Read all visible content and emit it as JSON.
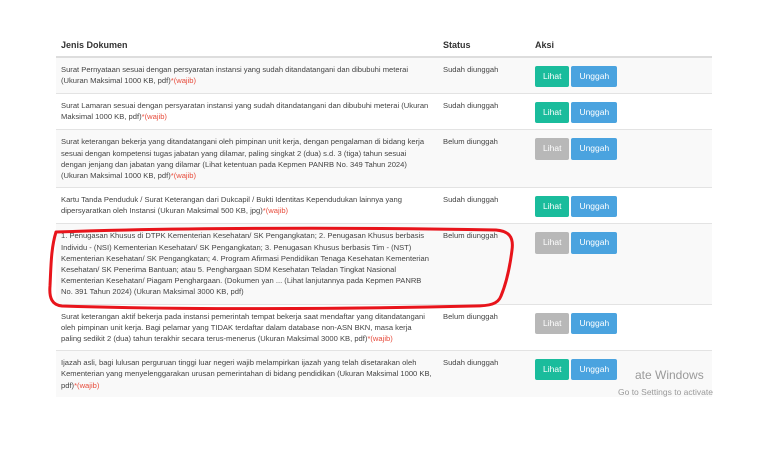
{
  "table": {
    "headers": {
      "doc": "Jenis Dokumen",
      "status": "Status",
      "action": "Aksi"
    },
    "buttons": {
      "view": "Lihat",
      "upload": "Unggah"
    },
    "rows": [
      {
        "doc": "Surat Pernyataan sesuai dengan persyaratan instansi yang sudah ditandatangani dan dibubuhi meterai (Ukuran Maksimal 1000 KB, pdf)",
        "req": "*(wajib)",
        "status": "Sudah diunggah",
        "view_enabled": true
      },
      {
        "doc": "Surat Lamaran sesuai dengan persyaratan instansi yang sudah ditandatangani dan dibubuhi meterai (Ukuran Maksimal 1000 KB, pdf)",
        "req": "*(wajib)",
        "status": "Sudah diunggah",
        "view_enabled": true
      },
      {
        "doc": "Surat keterangan bekerja yang ditandatangani oleh pimpinan unit kerja, dengan pengalaman di bidang kerja sesuai dengan kompetensi tugas jabatan yang dilamar, paling singkat 2 (dua) s.d. 3 (tiga) tahun sesuai dengan jenjang dan jabatan yang dilamar (Lihat ketentuan pada Kepmen PANRB No. 349 Tahun 2024) (Ukuran Maksimal 1000 KB, pdf)",
        "req": "*(wajib)",
        "status": "Belum diunggah",
        "view_enabled": false
      },
      {
        "doc": "Kartu Tanda Penduduk / Surat Keterangan dari Dukcapil / Bukti Identitas Kependudukan lainnya yang dipersyaratkan oleh Instansi (Ukuran Maksimal 500 KB, jpg)",
        "req": "*(wajib)",
        "status": "Sudah diunggah",
        "view_enabled": true
      },
      {
        "doc": "1. Penugasan Khusus di DTPK Kementerian Kesehatan/ SK Pengangkatan; 2. Penugasan Khusus berbasis Individu - (NSI) Kementerian Kesehatan/ SK Pengangkatan; 3. Penugasan Khusus berbasis Tim - (NST) Kementerian Kesehatan/ SK Pengangkatan; 4. Program Afirmasi Pendidikan Tenaga Kesehatan Kementerian Kesehatan/ SK Penerima Bantuan; atau 5. Penghargaan SDM Kesehatan Teladan Tingkat Nasional Kementerian Kesehatan/ Piagam Penghargaan. (Dokumen yan ... (Lihat lanjutannya pada Kepmen PANRB No. 391 Tahun 2024) (Ukuran Maksimal 3000 KB, pdf)",
        "req": "",
        "status": "Belum diunggah",
        "view_enabled": false
      },
      {
        "doc": "Surat keterangan aktif bekerja pada instansi pemerintah tempat bekerja saat mendaftar yang ditandatangani oleh pimpinan unit kerja. Bagi pelamar yang TIDAK terdaftar dalam database non-ASN BKN, masa kerja paling sedikit 2 (dua) tahun terakhir secara terus-menerus (Ukuran Maksimal 3000 KB, pdf)",
        "req": "*(wajib)",
        "status": "Belum diunggah",
        "view_enabled": false
      },
      {
        "doc": "Ijazah asli, bagi lulusan perguruan tinggi luar negeri wajib melampirkan ijazah yang telah disetarakan oleh Kementerian yang menyelenggarakan urusan pemerintahan di bidang pendidikan (Ukuran Maksimal 1000 KB, pdf)",
        "req": "*(wajib)",
        "status": "Sudah diunggah",
        "view_enabled": true
      }
    ]
  },
  "watermark": {
    "line1": "ate Windows",
    "line2": "Go to Settings to activate"
  },
  "colors": {
    "view": "#1abc9c",
    "view_disabled": "#b8b8b8",
    "upload": "#4aa3df",
    "required": "#e74c3c",
    "annotation": "#e8141b"
  }
}
